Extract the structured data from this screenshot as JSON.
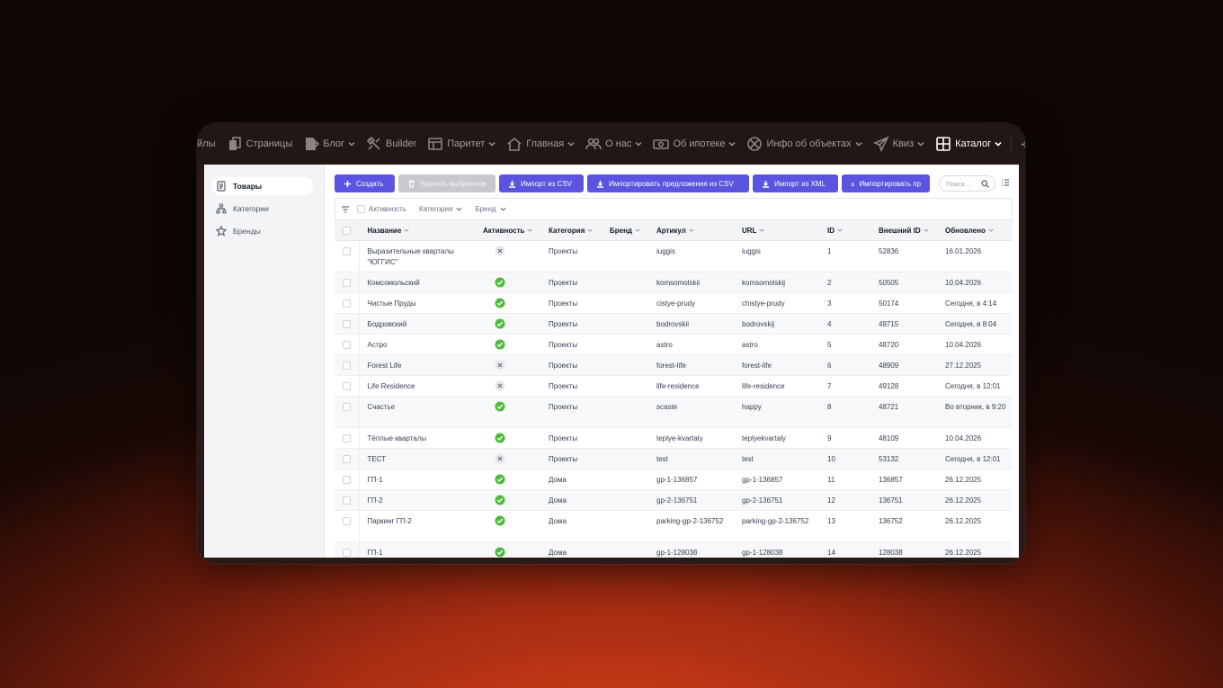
{
  "topnav": {
    "items": [
      {
        "label": "айлы",
        "icon": "none",
        "chevron": false
      },
      {
        "label": "Страницы",
        "icon": "pages-icon",
        "chevron": false
      },
      {
        "label": "Блог",
        "icon": "blog-icon",
        "chevron": true
      },
      {
        "label": "Builder",
        "icon": "builder-icon",
        "chevron": false
      },
      {
        "label": "Паритет",
        "icon": "layout-icon",
        "chevron": true
      },
      {
        "label": "Главная",
        "icon": "home-icon",
        "chevron": true
      },
      {
        "label": "О нас",
        "icon": "people-icon",
        "chevron": true
      },
      {
        "label": "Об ипотеке",
        "icon": "money-icon",
        "chevron": true
      },
      {
        "label": "Инфо об объектах",
        "icon": "globe-icon",
        "chevron": true
      },
      {
        "label": "Квиз",
        "icon": "paper-plane-icon",
        "chevron": true
      },
      {
        "label": "Каталог",
        "icon": "grid-icon",
        "chevron": true,
        "active": true
      }
    ]
  },
  "sidebar": {
    "items": [
      {
        "label": "Товары",
        "icon": "book-icon",
        "active": true
      },
      {
        "label": "Категории",
        "icon": "hierarchy-icon",
        "active": false
      },
      {
        "label": "Бренды",
        "icon": "star-icon",
        "active": false
      }
    ]
  },
  "toolbar": {
    "create": "Создать",
    "delete_selected": "Удалить выбранное",
    "import_csv": "Импорт из CSV",
    "import_offers_csv": "Импортировать предложения из CSV",
    "import_xml": "Импорт из XML",
    "import_more": "Импортировать пр",
    "search_placeholder": "Поиск..."
  },
  "filters": {
    "activity": "Активность",
    "category": "Категория",
    "brand": "Бренд"
  },
  "table": {
    "columns": [
      "Название",
      "Активность",
      "Категория",
      "Бренд",
      "Артикул",
      "URL",
      "ID",
      "Внешний ID",
      "Обновлено"
    ],
    "rows": [
      {
        "name": "Выразительные кварталы \"ЮГГИС\"",
        "active": false,
        "category": "Проекты",
        "brand": "",
        "sku": "iuggis",
        "url": "iuggis",
        "id": "1",
        "ext_id": "52836",
        "updated": "16.01.2026"
      },
      {
        "name": "Комсомольский",
        "active": true,
        "category": "Проекты",
        "brand": "",
        "sku": "komsomolskii",
        "url": "komsomolskij",
        "id": "2",
        "ext_id": "50505",
        "updated": "10.04.2026"
      },
      {
        "name": "Чистые Пруды",
        "active": true,
        "category": "Проекты",
        "brand": "",
        "sku": "cistye-prudy",
        "url": "chistye-prudy",
        "id": "3",
        "ext_id": "50174",
        "updated": "Сегодня, в 4:14"
      },
      {
        "name": "Бодровский",
        "active": true,
        "category": "Проекты",
        "brand": "",
        "sku": "bodrovskii",
        "url": "bodrovskij",
        "id": "4",
        "ext_id": "49715",
        "updated": "Сегодня, в 8:04"
      },
      {
        "name": "Астро",
        "active": true,
        "category": "Проекты",
        "brand": "",
        "sku": "astro",
        "url": "astro",
        "id": "5",
        "ext_id": "48720",
        "updated": "10.04.2026"
      },
      {
        "name": "Forest Life",
        "active": false,
        "category": "Проекты",
        "brand": "",
        "sku": "forest-life",
        "url": "forest-life",
        "id": "6",
        "ext_id": "48909",
        "updated": "27.12.2025"
      },
      {
        "name": "Life Residence",
        "active": false,
        "category": "Проекты",
        "brand": "",
        "sku": "life-residence",
        "url": "life-residence",
        "id": "7",
        "ext_id": "49128",
        "updated": "Сегодня, в 12:01"
      },
      {
        "name": "Счастье",
        "active": true,
        "category": "Проекты",
        "brand": "",
        "sku": "scaste",
        "url": "happy",
        "id": "8",
        "ext_id": "48721",
        "updated": "Во вторник, в 9:20"
      },
      {
        "name": "Тёплые кварталы",
        "active": true,
        "category": "Проекты",
        "brand": "",
        "sku": "teplye-kvartaly",
        "url": "teplyekvartaly",
        "id": "9",
        "ext_id": "48109",
        "updated": "10.04.2026"
      },
      {
        "name": "ТЕСТ",
        "active": false,
        "category": "Проекты",
        "brand": "",
        "sku": "test",
        "url": "test",
        "id": "10",
        "ext_id": "53132",
        "updated": "Сегодня, в 12:01"
      },
      {
        "name": "ГП-1",
        "active": true,
        "category": "Дома",
        "brand": "",
        "sku": "gp-1-136857",
        "url": "gp-1-136857",
        "id": "11",
        "ext_id": "136857",
        "updated": "26.12.2025"
      },
      {
        "name": "ГП-2",
        "active": true,
        "category": "Дома",
        "brand": "",
        "sku": "gp-2-136751",
        "url": "gp-2-136751",
        "id": "12",
        "ext_id": "136751",
        "updated": "26.12.2025"
      },
      {
        "name": "Паркинг ГП-2",
        "active": true,
        "category": "Дома",
        "brand": "",
        "sku": "parking-gp-2-136752",
        "url": "parking-gp-2-136752",
        "id": "13",
        "ext_id": "136752",
        "updated": "26.12.2025"
      },
      {
        "name": "ГП-1",
        "active": true,
        "category": "Дома",
        "brand": "",
        "sku": "gp-1-128038",
        "url": "gp-1-128038",
        "id": "14",
        "ext_id": "128038",
        "updated": "26.12.2025"
      }
    ]
  },
  "colors": {
    "accent": "#5b54e0",
    "active_status": "#4cbb3c",
    "inactive_status": "#e5e7eb"
  }
}
